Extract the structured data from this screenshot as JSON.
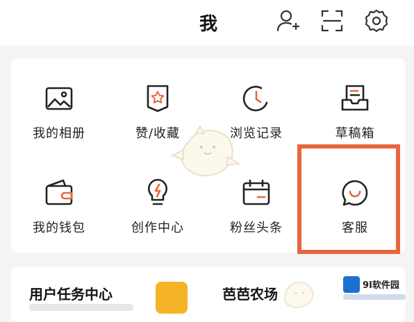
{
  "header": {
    "title": "我",
    "icons": [
      "add-user-icon",
      "scan-icon",
      "settings-icon"
    ]
  },
  "grid": {
    "items": [
      {
        "label": "我的相册",
        "icon": "album-icon"
      },
      {
        "label": "赞/收藏",
        "icon": "like-collect-icon"
      },
      {
        "label": "浏览记录",
        "icon": "history-icon"
      },
      {
        "label": "草稿箱",
        "icon": "drafts-icon"
      },
      {
        "label": "我的钱包",
        "icon": "wallet-icon"
      },
      {
        "label": "创作中心",
        "icon": "creator-center-icon"
      },
      {
        "label": "粉丝头条",
        "icon": "fans-headline-icon"
      },
      {
        "label": "客服",
        "icon": "customer-service-icon"
      }
    ],
    "highlight_color": "#e8663e"
  },
  "promo": {
    "left_title": "用户任务中心",
    "right_title": "芭芭农场"
  },
  "watermark": {
    "text": "9I软件园"
  }
}
